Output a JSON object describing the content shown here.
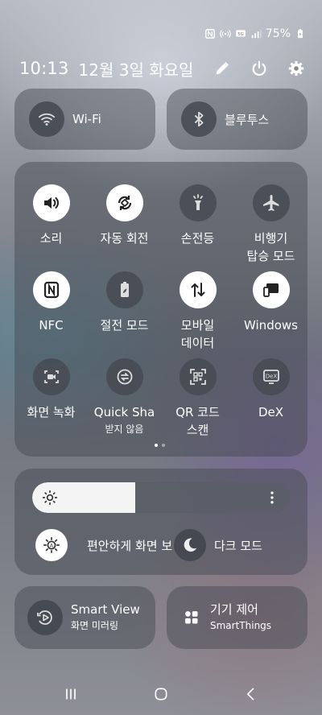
{
  "status": {
    "battery": "75%",
    "icons": [
      "nfc-icon",
      "hotspot-icon",
      "volte-icon",
      "signal-icon",
      "battery-icon"
    ]
  },
  "header": {
    "time": "10:13",
    "date": "12월 3일 화요일",
    "actions": [
      "edit-icon",
      "power-icon",
      "settings-icon"
    ]
  },
  "connections": {
    "wifi": {
      "label": "Wi-Fi",
      "icon": "wifi-icon"
    },
    "bluetooth": {
      "label": "블루투스",
      "icon": "bluetooth-icon"
    }
  },
  "quick_settings": [
    {
      "label": "소리",
      "icon": "sound-icon",
      "active": true
    },
    {
      "label": "자동 회전",
      "icon": "auto-rotate-icon",
      "active": true
    },
    {
      "label": "손전등",
      "icon": "flashlight-icon",
      "active": false
    },
    {
      "label": "비행기\n탑승 모드",
      "icon": "airplane-icon",
      "active": false
    },
    {
      "label": "NFC",
      "icon": "nfc-icon",
      "active": true
    },
    {
      "label": "절전 모드",
      "icon": "battery-saver-icon",
      "active": false
    },
    {
      "label": "모바일\n데이터",
      "icon": "mobile-data-icon",
      "active": true
    },
    {
      "label": "Windows",
      "icon": "link-to-windows-icon",
      "active": true
    },
    {
      "label": "화면 녹화",
      "icon": "screen-recorder-icon",
      "active": false
    },
    {
      "label": "Quick Sha",
      "sub": "받지 않음",
      "icon": "quick-share-icon",
      "active": false
    },
    {
      "label": "QR 코드\n스캔",
      "icon": "qr-scan-icon",
      "active": false
    },
    {
      "label": "DeX",
      "icon": "dex-icon",
      "active": false
    }
  ],
  "pager": {
    "pages": 2,
    "current": 1
  },
  "brightness": {
    "level": 0.4,
    "eye_comfort_label": "편안하게 화면 보",
    "dark_mode_label": "다크 모드"
  },
  "smart_view": {
    "title": "Smart View",
    "subtitle": "화면 미러링",
    "icon": "smart-view-icon"
  },
  "device_control": {
    "title": "기기 제어",
    "subtitle": "SmartThings",
    "icon": "device-control-icon"
  },
  "nav": [
    "recents-icon",
    "home-icon",
    "back-icon"
  ]
}
